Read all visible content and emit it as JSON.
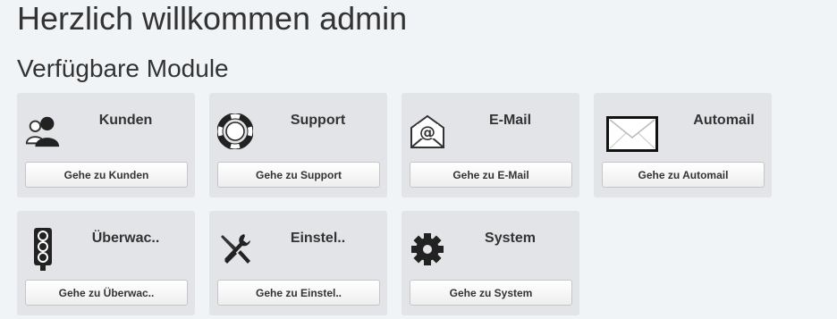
{
  "header": {
    "welcome": "Herzlich willkommen admin",
    "subtitle": "Verfügbare Module"
  },
  "modules": [
    {
      "title": "Kunden",
      "button": "Gehe zu Kunden",
      "icon": "users-icon"
    },
    {
      "title": "Support",
      "button": "Gehe zu Support",
      "icon": "lifebuoy-icon"
    },
    {
      "title": "E-Mail",
      "button": "Gehe zu E-Mail",
      "icon": "email-at-icon"
    },
    {
      "title": "Automail",
      "button": "Gehe zu Automail",
      "icon": "envelope-icon"
    },
    {
      "title": "Überwac..",
      "button": "Gehe zu Überwac..",
      "icon": "traffic-light-icon"
    },
    {
      "title": "Einstel..",
      "button": "Gehe zu Einstel..",
      "icon": "tools-icon"
    },
    {
      "title": "System",
      "button": "Gehe zu System",
      "icon": "gear-icon"
    }
  ],
  "colors": {
    "background": "#f1f4f7",
    "tile": "#e2e4e8",
    "text": "#333333"
  }
}
